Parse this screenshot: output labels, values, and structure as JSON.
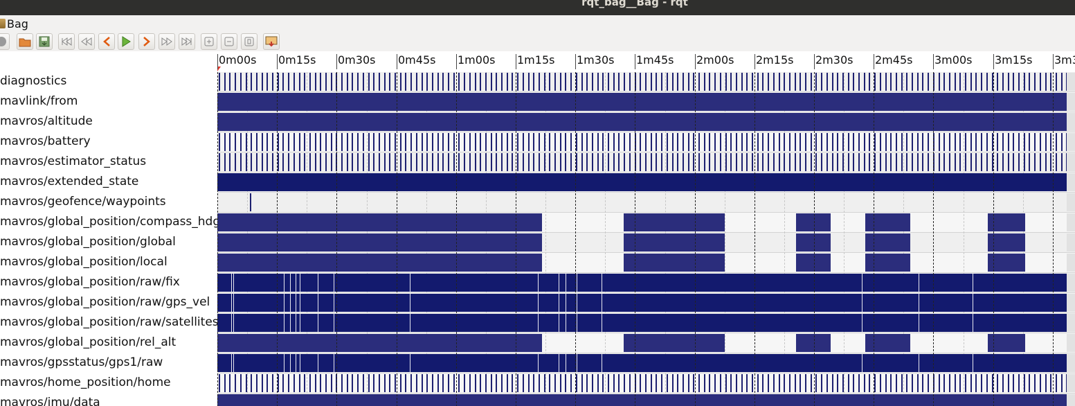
{
  "window": {
    "title": "rqt_bag__Bag - rqt"
  },
  "menubar": {
    "bag_label": "Bag"
  },
  "toolbar": {
    "buttons": [
      {
        "name": "record-button",
        "icon": "record-icon"
      },
      {
        "name": "load-bag-button",
        "icon": "folder-open-icon"
      },
      {
        "name": "save-bag-button",
        "icon": "save-icon"
      },
      {
        "name": "go-to-start-button",
        "icon": "skip-start-icon"
      },
      {
        "name": "rewind-button",
        "icon": "rewind-icon"
      },
      {
        "name": "play-backward-button",
        "icon": "play-backward-icon"
      },
      {
        "name": "play-button",
        "icon": "play-icon"
      },
      {
        "name": "play-forward-step-button",
        "icon": "step-forward-icon"
      },
      {
        "name": "fast-forward-button",
        "icon": "fast-forward-icon"
      },
      {
        "name": "go-to-end-button",
        "icon": "skip-end-icon"
      },
      {
        "name": "zoom-in-button",
        "icon": "zoom-in-icon"
      },
      {
        "name": "zoom-out-button",
        "icon": "zoom-out-icon"
      },
      {
        "name": "zoom-reset-button",
        "icon": "zoom-reset-icon"
      },
      {
        "name": "thumbnails-button",
        "icon": "thumbnails-icon"
      }
    ]
  },
  "timeline": {
    "tick_labels": [
      "0m00s",
      "0m15s",
      "0m30s",
      "0m45s",
      "1m00s",
      "1m15s",
      "1m30s",
      "1m45s",
      "2m00s",
      "2m15s",
      "2m30s",
      "2m45s",
      "3m00s",
      "3m15s",
      "3m3"
    ],
    "topics": [
      {
        "name": "diagnostics",
        "pattern": "ticks"
      },
      {
        "name": "mavlink/from",
        "pattern": "solid"
      },
      {
        "name": "mavros/altitude",
        "pattern": "solid"
      },
      {
        "name": "mavros/battery",
        "pattern": "ticks"
      },
      {
        "name": "mavros/estimator_status",
        "pattern": "ticks"
      },
      {
        "name": "mavros/extended_state",
        "pattern": "dense"
      },
      {
        "name": "mavros/geofence/waypoints",
        "pattern": "single"
      },
      {
        "name": "mavros/global_position/compass_hdg",
        "pattern": "segments"
      },
      {
        "name": "mavros/global_position/global",
        "pattern": "segments"
      },
      {
        "name": "mavros/global_position/local",
        "pattern": "segments"
      },
      {
        "name": "mavros/global_position/raw/fix",
        "pattern": "gps"
      },
      {
        "name": "mavros/global_position/raw/gps_vel",
        "pattern": "gps"
      },
      {
        "name": "mavros/global_position/raw/satellites",
        "pattern": "gps"
      },
      {
        "name": "mavros/global_position/rel_alt",
        "pattern": "segments"
      },
      {
        "name": "mavros/gpsstatus/gps1/raw",
        "pattern": "gps"
      },
      {
        "name": "mavros/home_position/home",
        "pattern": "ticks"
      },
      {
        "name": "mavros/imu/data",
        "pattern": "solid"
      }
    ]
  },
  "colors": {
    "message_block": "#2b2d7c",
    "dense_block": "#131a6e",
    "title_bar": "#2f2f2d",
    "row_background": "#eeeeee"
  }
}
